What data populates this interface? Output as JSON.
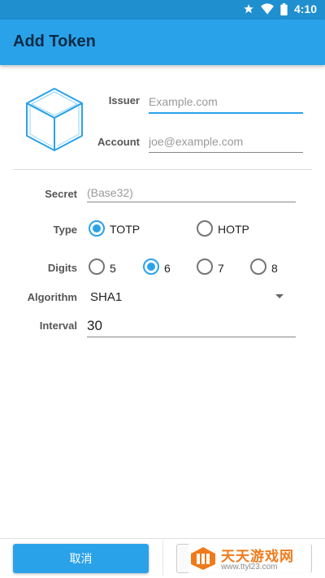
{
  "status_bar": {
    "time": "4:10"
  },
  "app_bar": {
    "title": "Add Token"
  },
  "form": {
    "issuer": {
      "label": "Issuer",
      "placeholder": "Example.com"
    },
    "account": {
      "label": "Account",
      "placeholder": "joe@example.com"
    },
    "secret": {
      "label": "Secret",
      "placeholder": "(Base32)"
    },
    "type": {
      "label": "Type",
      "options": [
        "TOTP",
        "HOTP"
      ],
      "selected": "TOTP"
    },
    "digits": {
      "label": "Digits",
      "options": [
        "5",
        "6",
        "7",
        "8"
      ],
      "selected": "6"
    },
    "algorithm": {
      "label": "Algorithm",
      "value": "SHA1"
    },
    "interval": {
      "label": "Interval",
      "value": "30"
    }
  },
  "actions": {
    "cancel_label": "取消"
  },
  "watermark": {
    "brand": "天天游戏网",
    "url": "www.ttyl23.com"
  },
  "colors": {
    "accent": "#2aa2ea",
    "status_bar": "#1f8fd0",
    "watermark": "#f07a1a"
  }
}
